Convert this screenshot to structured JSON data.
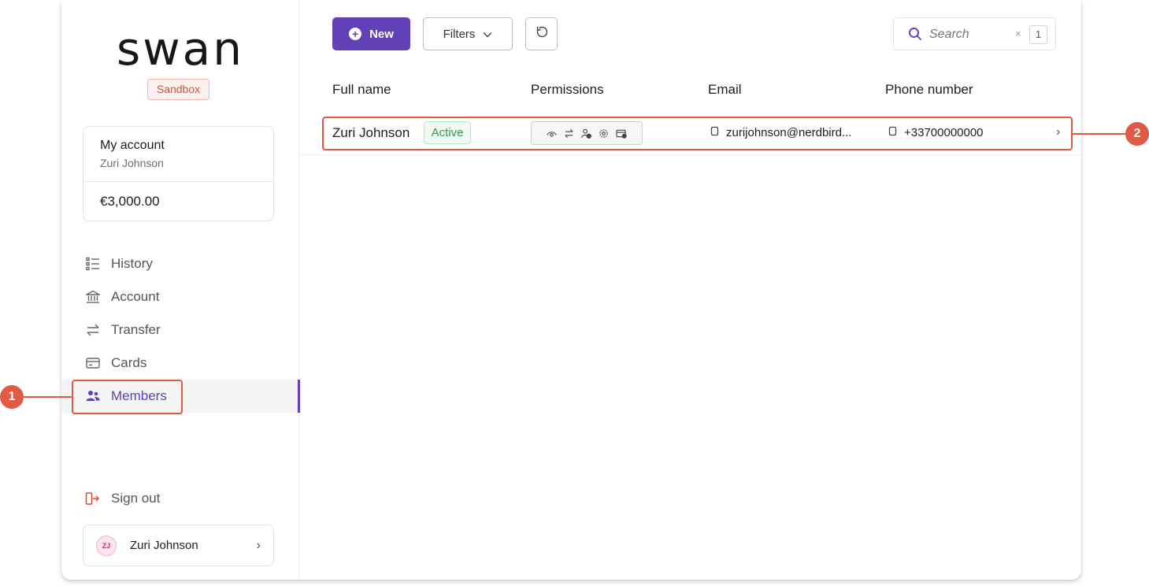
{
  "brand": {
    "logo": "swan",
    "env_badge": "Sandbox"
  },
  "account_card": {
    "title": "My account",
    "holder": "Zuri Johnson",
    "balance": "€3,000.00"
  },
  "sidebar": {
    "items": [
      {
        "label": "History",
        "icon": "history-list-icon"
      },
      {
        "label": "Account",
        "icon": "bank-icon"
      },
      {
        "label": "Transfer",
        "icon": "transfer-arrows-icon"
      },
      {
        "label": "Cards",
        "icon": "card-icon"
      },
      {
        "label": "Members",
        "icon": "people-icon",
        "active": true
      }
    ],
    "sign_out": "Sign out",
    "user": {
      "initials": "ZJ",
      "name": "Zuri Johnson"
    }
  },
  "toolbar": {
    "new_label": "New",
    "filters_label": "Filters",
    "search_placeholder": "Search",
    "search_clear": "×",
    "search_count": "1"
  },
  "table": {
    "columns": [
      "Full name",
      "Permissions",
      "Email",
      "Phone number"
    ],
    "rows": [
      {
        "full_name": "Zuri Johnson",
        "status": "Active",
        "email": "zurijohnson@nerdbird...",
        "phone": "+33700000000",
        "permission_icons": [
          "view-icon",
          "transfer-icon",
          "add-member-icon",
          "settings-icon",
          "card-add-icon"
        ]
      }
    ]
  },
  "annotations": {
    "callout_1": "1",
    "callout_2": "2"
  },
  "colors": {
    "accent": "#6240b5",
    "annotation": "#e05a45",
    "success": "#2e9b4d",
    "sandbox": "#d2523f"
  }
}
